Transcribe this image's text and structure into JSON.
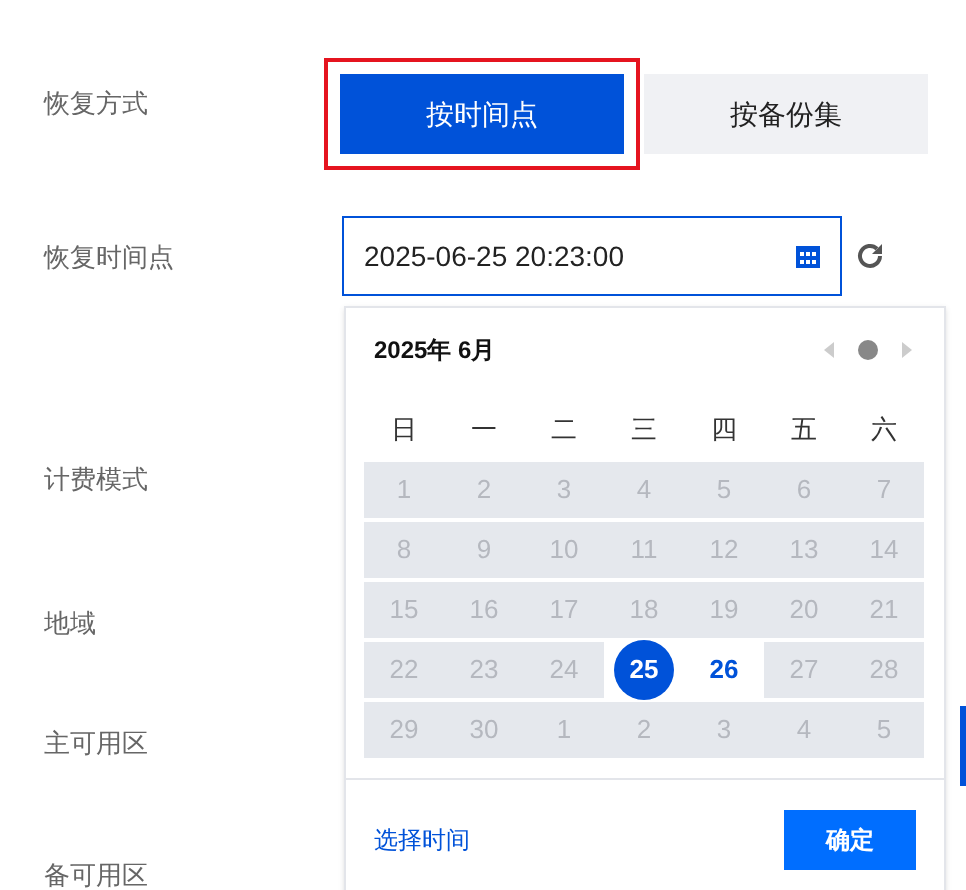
{
  "form_labels": [
    "恢复方式",
    "恢复时间点",
    "计费模式",
    "地域",
    "主可用区",
    "备可用区"
  ],
  "restore_modes": [
    {
      "label": "按时间点",
      "selected": true
    },
    {
      "label": "按备份集",
      "selected": false
    }
  ],
  "time_field": {
    "value": "2025-06-25 20:23:00"
  },
  "calendar": {
    "title": "2025年 6月",
    "weekdays": [
      "日",
      "一",
      "二",
      "三",
      "四",
      "五",
      "六"
    ],
    "weeks": [
      [
        {
          "day": "1",
          "selected": false,
          "disabled": true
        },
        {
          "day": "2",
          "selected": false,
          "disabled": true
        },
        {
          "day": "3",
          "selected": false,
          "disabled": true
        },
        {
          "day": "4",
          "selected": false,
          "disabled": true
        },
        {
          "day": "5",
          "selected": false,
          "disabled": true
        },
        {
          "day": "6",
          "selected": false,
          "disabled": true
        },
        {
          "day": "7",
          "selected": false,
          "disabled": true
        }
      ],
      [
        {
          "day": "8",
          "selected": false,
          "disabled": true
        },
        {
          "day": "9",
          "selected": false,
          "disabled": true
        },
        {
          "day": "10",
          "selected": false,
          "disabled": true
        },
        {
          "day": "11",
          "selected": false,
          "disabled": true
        },
        {
          "day": "12",
          "selected": false,
          "disabled": true
        },
        {
          "day": "13",
          "selected": false,
          "disabled": true
        },
        {
          "day": "14",
          "selected": false,
          "disabled": true
        }
      ],
      [
        {
          "day": "15",
          "selected": false,
          "disabled": true
        },
        {
          "day": "16",
          "selected": false,
          "disabled": true
        },
        {
          "day": "17",
          "selected": false,
          "disabled": true
        },
        {
          "day": "18",
          "selected": false,
          "disabled": true
        },
        {
          "day": "19",
          "selected": false,
          "disabled": true
        },
        {
          "day": "20",
          "selected": false,
          "disabled": true
        },
        {
          "day": "21",
          "selected": false,
          "disabled": true
        }
      ],
      [
        {
          "day": "22",
          "selected": false,
          "disabled": true
        },
        {
          "day": "23",
          "selected": false,
          "disabled": true
        },
        {
          "day": "24",
          "selected": false,
          "disabled": true
        },
        {
          "day": "25",
          "selected": true,
          "disabled": false
        },
        {
          "day": "26",
          "selected": false,
          "disabled": false
        },
        {
          "day": "27",
          "selected": false,
          "disabled": true
        },
        {
          "day": "28",
          "selected": false,
          "disabled": true
        }
      ],
      [
        {
          "day": "29",
          "selected": false,
          "disabled": true
        },
        {
          "day": "30",
          "selected": false,
          "disabled": true
        },
        {
          "day": "1",
          "selected": false,
          "disabled": true
        },
        {
          "day": "2",
          "selected": false,
          "disabled": true
        },
        {
          "day": "3",
          "selected": false,
          "disabled": true
        },
        {
          "day": "4",
          "selected": false,
          "disabled": true
        },
        {
          "day": "5",
          "selected": false,
          "disabled": true
        }
      ]
    ],
    "time_link": "选择时间",
    "confirm": "确定"
  }
}
